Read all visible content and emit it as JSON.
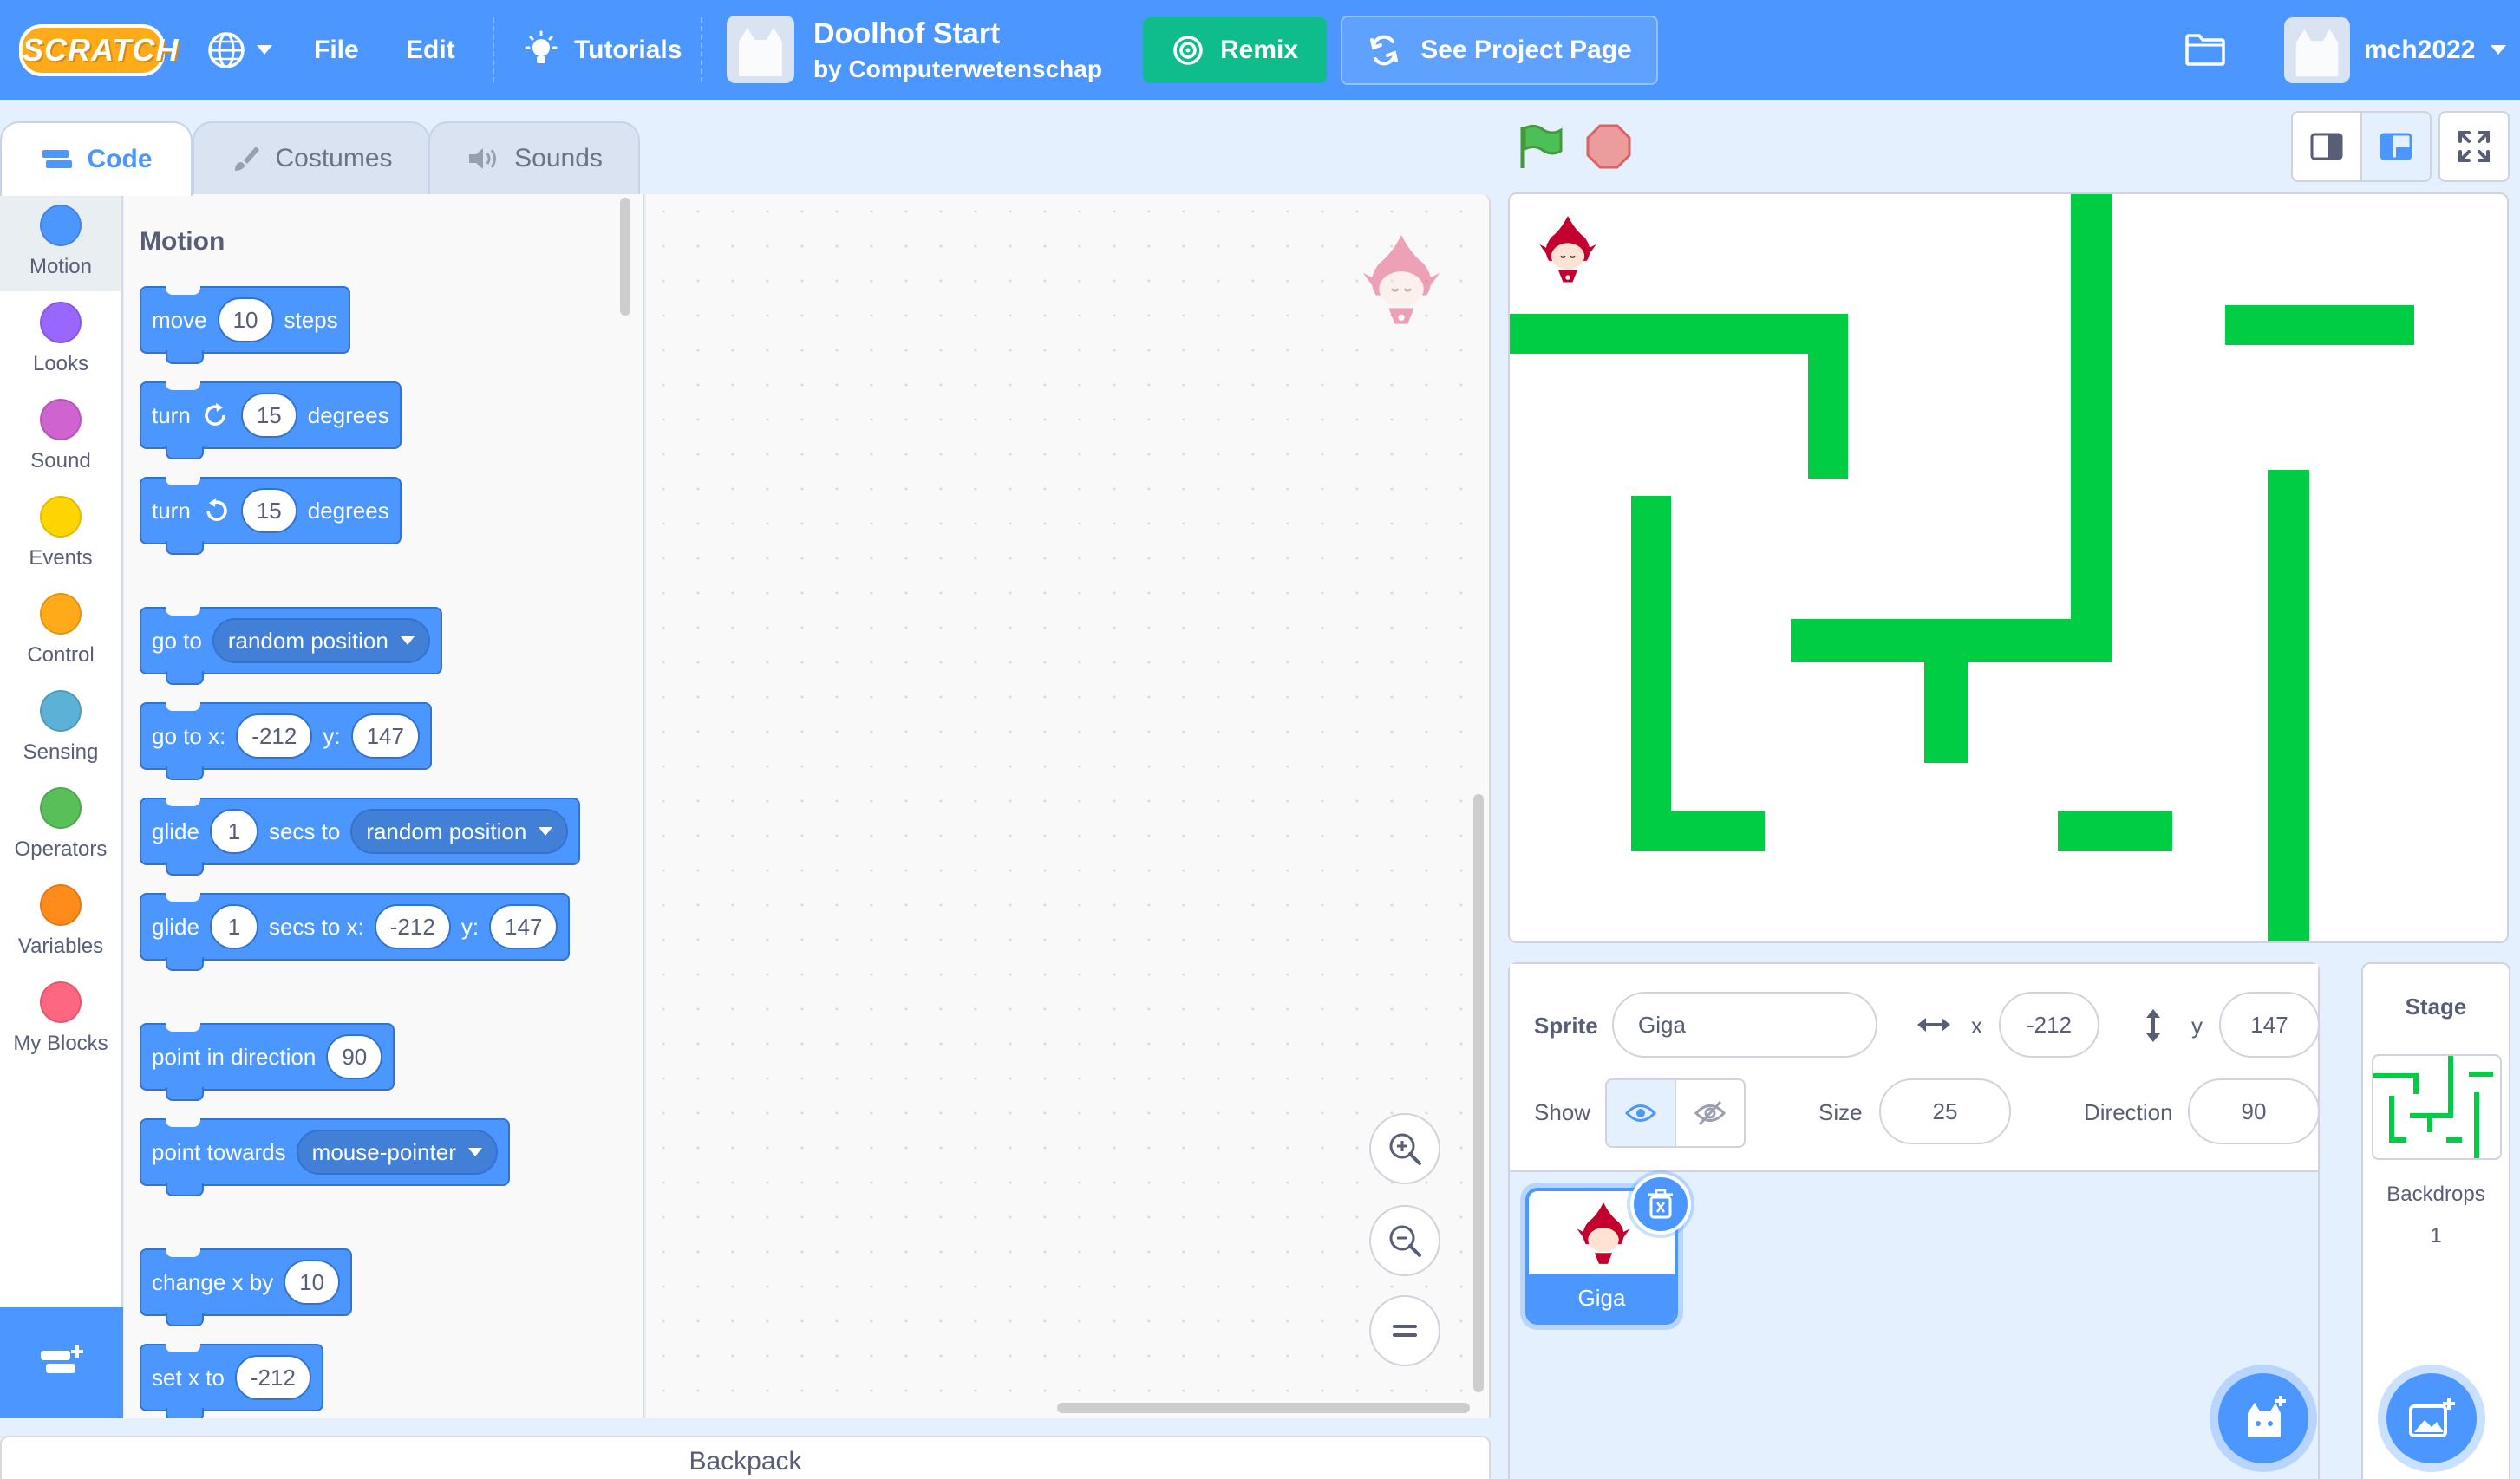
{
  "menubar": {
    "logo_text": "SCRATCH",
    "file": "File",
    "edit": "Edit",
    "tutorials": "Tutorials",
    "project_title": "Doolhof Start",
    "project_author": "by Computerwetenschap",
    "remix": "Remix",
    "see_project_page": "See Project Page",
    "username": "mch2022"
  },
  "tabs": {
    "code": "Code",
    "costumes": "Costumes",
    "sounds": "Sounds"
  },
  "categories": [
    {
      "label": "Motion",
      "color": "#4c97ff"
    },
    {
      "label": "Looks",
      "color": "#9966ff"
    },
    {
      "label": "Sound",
      "color": "#cf63cf"
    },
    {
      "label": "Events",
      "color": "#ffd500"
    },
    {
      "label": "Control",
      "color": "#ffab19"
    },
    {
      "label": "Sensing",
      "color": "#5cb1d6"
    },
    {
      "label": "Operators",
      "color": "#59c059"
    },
    {
      "label": "Variables",
      "color": "#ff8c1a"
    },
    {
      "label": "My Blocks",
      "color": "#ff6680"
    }
  ],
  "palette": {
    "title": "Motion",
    "move": {
      "a": "move",
      "v": "10",
      "b": "steps"
    },
    "turn_right": {
      "a": "turn",
      "v": "15",
      "b": "degrees"
    },
    "turn_left": {
      "a": "turn",
      "v": "15",
      "b": "degrees"
    },
    "goto": {
      "a": "go to",
      "d": "random position"
    },
    "goto_xy": {
      "a": "go to x:",
      "x": "-212",
      "b": "y:",
      "y": "147"
    },
    "glide_to": {
      "a": "glide",
      "v": "1",
      "b": "secs to",
      "d": "random position"
    },
    "glide_xy": {
      "a": "glide",
      "v": "1",
      "b": "secs to x:",
      "x": "-212",
      "c": "y:",
      "y": "147"
    },
    "point_dir": {
      "a": "point in direction",
      "v": "90"
    },
    "point_towards": {
      "a": "point towards",
      "d": "mouse-pointer"
    },
    "change_x": {
      "a": "change x by",
      "v": "10"
    },
    "set_x": {
      "a": "set x to",
      "v": "-212"
    }
  },
  "backpack": "Backpack",
  "sprite_info": {
    "sprite_label": "Sprite",
    "sprite_name": "Giga",
    "x_label": "x",
    "x": "-212",
    "y_label": "y",
    "y": "147",
    "show_label": "Show",
    "size_label": "Size",
    "size": "25",
    "direction_label": "Direction",
    "direction": "90"
  },
  "sprites": [
    {
      "name": "Giga"
    }
  ],
  "stage_pane": {
    "title": "Stage",
    "backdrops_label": "Backdrops",
    "backdrops_count": "1"
  },
  "colors": {
    "accent": "#4c97ff",
    "remix": "#0fbd8c",
    "maze_green": "#00cc44"
  }
}
